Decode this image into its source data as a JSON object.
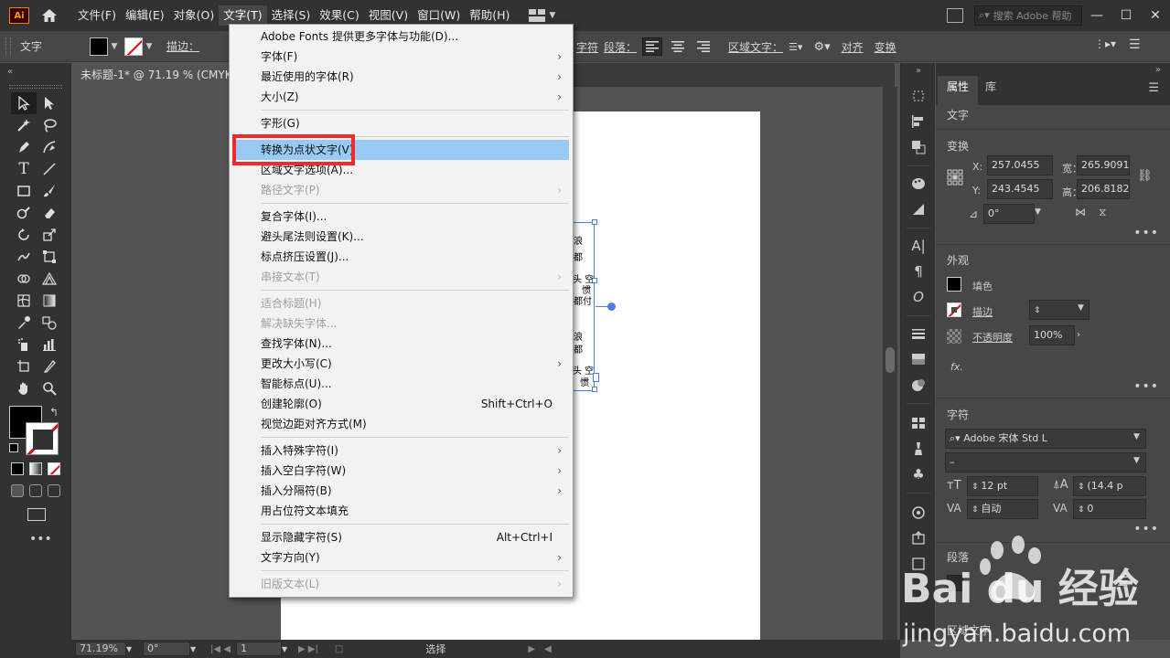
{
  "app": {
    "logo": "Ai",
    "menu": [
      "文件(F)",
      "编辑(E)",
      "对象(O)",
      "文字(T)",
      "选择(S)",
      "效果(C)",
      "视图(V)",
      "窗口(W)",
      "帮助(H)"
    ],
    "active_menu_index": 3,
    "search_placeholder": "搜索 Adobe 帮助",
    "accent": "#ff9a00",
    "highlight": "#99c9f5",
    "callout_color": "#ec2b2b"
  },
  "controlbar": {
    "label": "文字",
    "stroke_label": "描边：",
    "char_label": "字符",
    "para_label": "段落：",
    "area_type_label": "区域文字：",
    "align_label": "对齐",
    "transform_label": "变换"
  },
  "document": {
    "tab_title": "未标题-1* @ 71.19 % (CMYK"
  },
  "artboard_text": [
    "浪",
    "都",
    "头 空",
    "惯",
    "都付",
    "浪",
    "都",
    "头 空",
    "惯"
  ],
  "dropdown": {
    "items": [
      {
        "label": "Adobe Fonts 提供更多字体与功能(D)...",
        "disabled": false,
        "arrow": false,
        "shortcut": ""
      },
      {
        "label": "字体(F)",
        "disabled": false,
        "arrow": true,
        "shortcut": ""
      },
      {
        "label": "最近使用的字体(R)",
        "disabled": false,
        "arrow": true,
        "shortcut": ""
      },
      {
        "label": "大小(Z)",
        "disabled": false,
        "arrow": true,
        "shortcut": ""
      },
      {
        "label": "字形(G)",
        "disabled": false,
        "arrow": false,
        "shortcut": ""
      },
      {
        "label": "转换为点状文字(V)",
        "disabled": false,
        "arrow": false,
        "shortcut": "",
        "highlighted": true
      },
      {
        "label": "区域文字选项(A)...",
        "disabled": false,
        "arrow": false,
        "shortcut": ""
      },
      {
        "label": "路径文字(P)",
        "disabled": true,
        "arrow": true,
        "shortcut": ""
      },
      {
        "label": "复合字体(I)...",
        "disabled": false,
        "arrow": false,
        "shortcut": ""
      },
      {
        "label": "避头尾法则设置(K)...",
        "disabled": false,
        "arrow": false,
        "shortcut": ""
      },
      {
        "label": "标点挤压设置(J)...",
        "disabled": false,
        "arrow": false,
        "shortcut": ""
      },
      {
        "label": "串接文本(T)",
        "disabled": true,
        "arrow": true,
        "shortcut": ""
      },
      {
        "label": "适合标题(H)",
        "disabled": true,
        "arrow": false,
        "shortcut": ""
      },
      {
        "label": "解决缺失字体...",
        "disabled": true,
        "arrow": false,
        "shortcut": ""
      },
      {
        "label": "查找字体(N)...",
        "disabled": false,
        "arrow": false,
        "shortcut": ""
      },
      {
        "label": "更改大小写(C)",
        "disabled": false,
        "arrow": true,
        "shortcut": ""
      },
      {
        "label": "智能标点(U)...",
        "disabled": false,
        "arrow": false,
        "shortcut": ""
      },
      {
        "label": "创建轮廓(O)",
        "disabled": false,
        "arrow": false,
        "shortcut": "Shift+Ctrl+O"
      },
      {
        "label": "视觉边距对齐方式(M)",
        "disabled": false,
        "arrow": false,
        "shortcut": ""
      },
      {
        "label": "插入特殊字符(I)",
        "disabled": false,
        "arrow": true,
        "shortcut": ""
      },
      {
        "label": "插入空白字符(W)",
        "disabled": false,
        "arrow": true,
        "shortcut": ""
      },
      {
        "label": "插入分隔符(B)",
        "disabled": false,
        "arrow": true,
        "shortcut": ""
      },
      {
        "label": "用占位符文本填充",
        "disabled": false,
        "arrow": false,
        "shortcut": ""
      },
      {
        "label": "显示隐藏字符(S)",
        "disabled": false,
        "arrow": false,
        "shortcut": "Alt+Ctrl+I"
      },
      {
        "label": "文字方向(Y)",
        "disabled": false,
        "arrow": true,
        "shortcut": ""
      },
      {
        "label": "旧版文本(L)",
        "disabled": true,
        "arrow": true,
        "shortcut": ""
      }
    ]
  },
  "properties": {
    "tab_properties": "属性",
    "tab_library": "库",
    "section_type": "文字",
    "transform": {
      "title": "变换",
      "x_label": "X:",
      "x": "257.0455",
      "y_label": "Y:",
      "y": "243.4545",
      "w_label": "宽：",
      "w": "265.9091",
      "h_label": "高：",
      "h": "206.8182",
      "angle": "0°"
    },
    "appearance": {
      "title": "外观",
      "fill": "填色",
      "stroke": "描边",
      "opacity_label": "不透明度",
      "opacity": "100%",
      "fx": "fx."
    },
    "character": {
      "title": "字符",
      "font": "Adobe 宋体 Std L",
      "style": "–",
      "size": "12 pt",
      "leading": "(14.4 p",
      "kerning": "自动",
      "tracking": "0"
    },
    "paragraph": {
      "title": "段落",
      "area_type": "区域文字"
    }
  },
  "statusbar": {
    "zoom": "71.19%",
    "rotation": "0°",
    "page": "1",
    "tool": "选择"
  },
  "watermark": {
    "brand": "Bai du 经验",
    "url": "jingyan.baidu.com"
  }
}
